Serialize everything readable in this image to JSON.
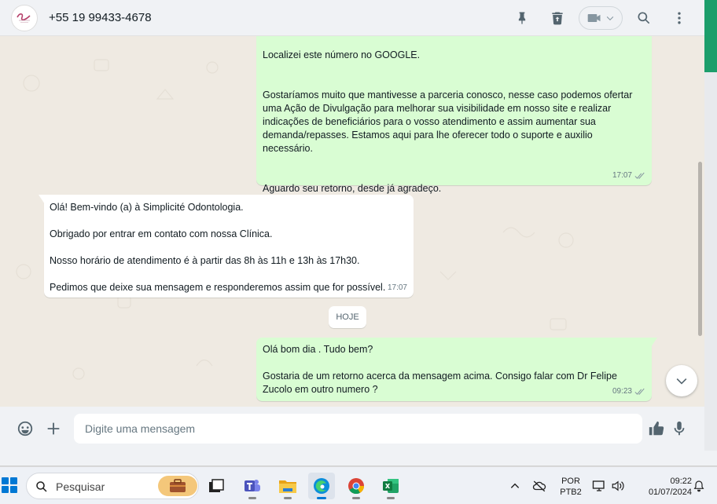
{
  "header": {
    "contact_phone": "+55 19 99433-4678"
  },
  "messages": [
    {
      "direction": "outgoing",
      "text": "Localizei este número no GOOGLE.\n\n\nGostaríamos muito que mantivesse a parceria conosco, nesse caso podemos ofertar uma Ação de Divulgação para melhorar sua visibilidade em nosso site e realizar indicações de beneficiários para o vosso atendimento e assim aumentar sua demanda/repasses. Estamos aqui para lhe oferecer todo o suporte e auxilio necessário.\n\n\nAguardo seu retorno, desde já agradeço.",
      "time": "17:07",
      "status": "delivered"
    },
    {
      "direction": "incoming",
      "text": "Olá! Bem-vindo (a) à Simplicité Odontologia.\n\nObrigado por entrar em contato com nossa Clínica.\n\nNosso horário de atendimento é à partir das 8h às 11h e 13h às 17h30.\n\nPedimos que deixe sua mensagem e responderemos assim que for possível.",
      "time": "17:07"
    },
    {
      "direction": "outgoing",
      "text": "Olá bom dia . Tudo bem?\n\nGostaria de um retorno acerca da mensagem acima. Consigo falar com Dr Felipe Zucolo em outro numero ?",
      "time": "09:23",
      "status": "delivered"
    }
  ],
  "date_divider": "HOJE",
  "composer": {
    "placeholder": "Digite uma mensagem"
  },
  "taskbar": {
    "search_label": "Pesquisar",
    "language_line1": "POR",
    "language_line2": "PTB2",
    "clock_time": "09:22",
    "clock_date": "01/07/2024"
  },
  "colors": {
    "outgoing_bubble": "#d9fdd3",
    "incoming_bubble": "#ffffff",
    "chat_background": "#efeae2",
    "accent_green": "#1c9e6b"
  },
  "icons": {
    "header": [
      "pin-icon",
      "delete-icon",
      "video-call-icon",
      "chevron-down-icon",
      "search-icon",
      "menu-icon"
    ],
    "composer": [
      "emoji-icon",
      "plus-icon",
      "thumbs-up-icon",
      "microphone-icon"
    ],
    "taskbar": [
      "windows-start-icon",
      "search-icon",
      "briefcase-icon",
      "task-view-icon",
      "teams-icon",
      "file-explorer-icon",
      "edge-icon",
      "chrome-icon",
      "excel-icon",
      "chevron-up-icon",
      "cloud-off-icon",
      "monitor-icon",
      "speaker-icon",
      "bell-icon"
    ]
  }
}
